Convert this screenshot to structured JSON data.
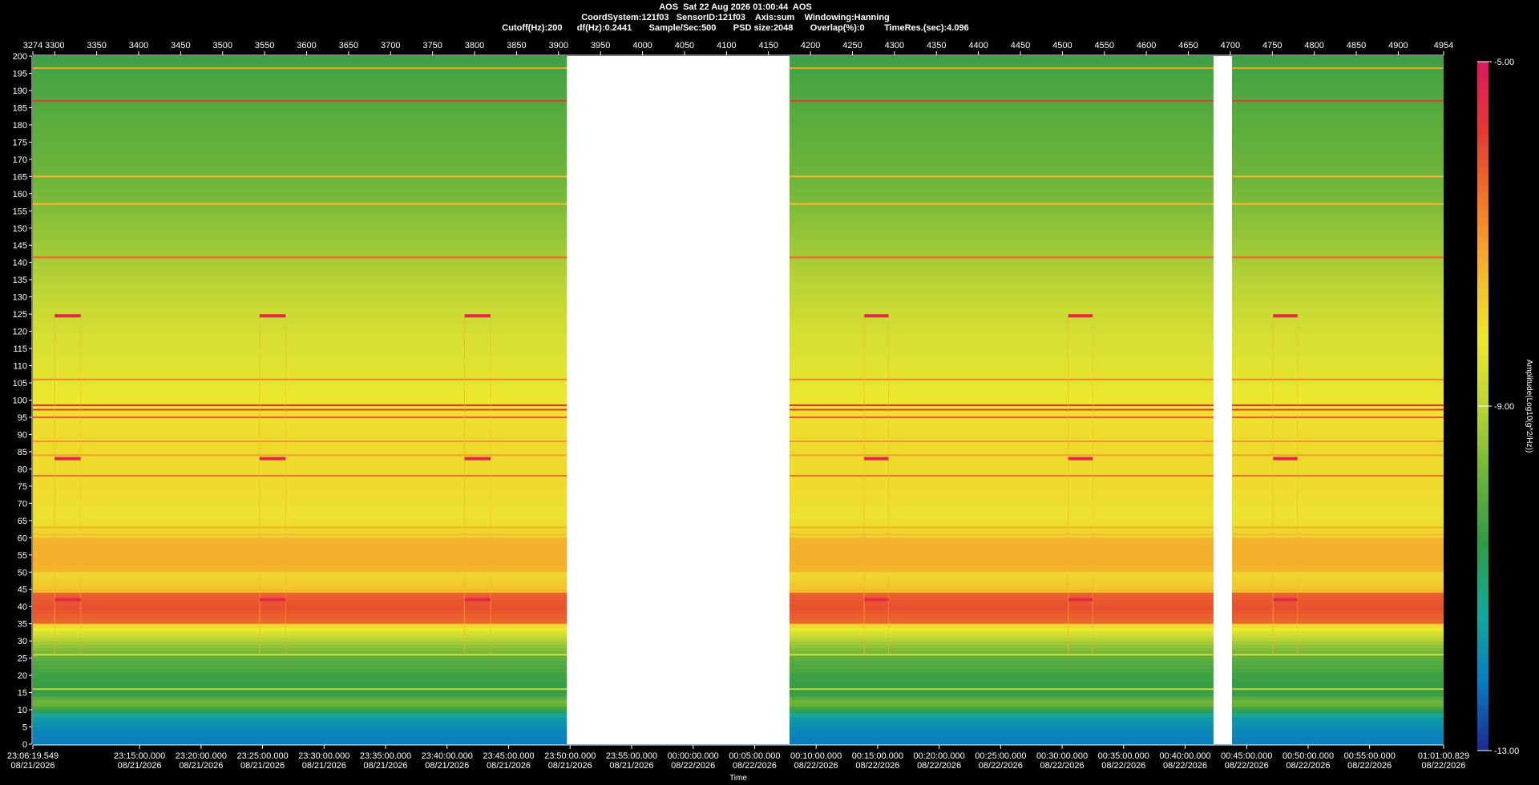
{
  "header": {
    "line1": "AOS  Sat 22 Aug 2026 01:00:44  AOS",
    "line2": "CoordSystem:121f03   SensorID:121f03    Axis:sum    Windowing:Hanning",
    "line3": "Cutoff(Hz):200      df(Hz):0.2441       Sample/Sec:500       PSD size:2048       Overlap(%):0        TimeRes.(sec):4.096"
  },
  "colors": {
    "background": "#000000",
    "colormap": [
      "#1b2a8f",
      "#0a7cc0",
      "#12a99a",
      "#2f9a47",
      "#6db43a",
      "#bcd436",
      "#ece82f",
      "#f5b32c",
      "#f0752a",
      "#e23a31",
      "#e0165f"
    ],
    "gap": "#ffffff"
  },
  "chart_data": {
    "type": "heatmap",
    "title": "",
    "xlabel": "Time",
    "ylabel": "",
    "ylim": [
      0,
      200
    ],
    "xlim_top": [
      3274,
      4954
    ],
    "top_ticks": [
      "3274",
      "3300",
      "3350",
      "3400",
      "3450",
      "3500",
      "3550",
      "3600",
      "3650",
      "3700",
      "3750",
      "3800",
      "3850",
      "3900",
      "3950",
      "4000",
      "4050",
      "4100",
      "4150",
      "4200",
      "4250",
      "4300",
      "4350",
      "4400",
      "4450",
      "4500",
      "4550",
      "4600",
      "4650",
      "4700",
      "4750",
      "4800",
      "4850",
      "4900",
      "4954"
    ],
    "y_ticks": [
      "0",
      "5",
      "10",
      "15",
      "20",
      "25",
      "30",
      "35",
      "40",
      "45",
      "50",
      "55",
      "60",
      "65",
      "70",
      "75",
      "80",
      "85",
      "90",
      "95",
      "100",
      "105",
      "110",
      "115",
      "120",
      "125",
      "130",
      "135",
      "140",
      "145",
      "150",
      "155",
      "160",
      "165",
      "170",
      "175",
      "180",
      "185",
      "190",
      "195",
      "200"
    ],
    "time_ticks": [
      {
        "time": "23:06:19.549",
        "date": "08/21/2026",
        "sec": 0
      },
      {
        "time": "23:15:00.000",
        "date": "08/21/2026",
        "sec": 520.451
      },
      {
        "time": "23:20:00.000",
        "date": "08/21/2026",
        "sec": 820.451
      },
      {
        "time": "23:25:00.000",
        "date": "08/21/2026",
        "sec": 1120.451
      },
      {
        "time": "23:30:00.000",
        "date": "08/21/2026",
        "sec": 1420.451
      },
      {
        "time": "23:35:00.000",
        "date": "08/21/2026",
        "sec": 1720.451
      },
      {
        "time": "23:40:00.000",
        "date": "08/21/2026",
        "sec": 2020.451
      },
      {
        "time": "23:45:00.000",
        "date": "08/21/2026",
        "sec": 2320.451
      },
      {
        "time": "23:50:00.000",
        "date": "08/21/2026",
        "sec": 2620.451
      },
      {
        "time": "23:55:00.000",
        "date": "08/21/2026",
        "sec": 2920.451
      },
      {
        "time": "00:00:00.000",
        "date": "08/22/2026",
        "sec": 3220.451
      },
      {
        "time": "00:05:00.000",
        "date": "08/22/2026",
        "sec": 3520.451
      },
      {
        "time": "00:10:00.000",
        "date": "08/22/2026",
        "sec": 3820.451
      },
      {
        "time": "00:15:00.000",
        "date": "08/22/2026",
        "sec": 4120.451
      },
      {
        "time": "00:20:00.000",
        "date": "08/22/2026",
        "sec": 4420.451
      },
      {
        "time": "00:25:00.000",
        "date": "08/22/2026",
        "sec": 4720.451
      },
      {
        "time": "00:30:00.000",
        "date": "08/22/2026",
        "sec": 5020.451
      },
      {
        "time": "00:35:00.000",
        "date": "08/22/2026",
        "sec": 5320.451
      },
      {
        "time": "00:40:00.000",
        "date": "08/22/2026",
        "sec": 5620.451
      },
      {
        "time": "00:45:00.000",
        "date": "08/22/2026",
        "sec": 5920.451
      },
      {
        "time": "00:50:00.000",
        "date": "08/22/2026",
        "sec": 6220.451
      },
      {
        "time": "00:55:00.000",
        "date": "08/22/2026",
        "sec": 6520.451
      },
      {
        "time": "01:01:00.829",
        "date": "08/22/2026",
        "sec": 6881.28
      }
    ],
    "time_range_sec": [
      0,
      6881.28
    ],
    "data_gaps": [
      {
        "from": 3910,
        "to": 4175
      },
      {
        "from": 4680,
        "to": 4702
      }
    ],
    "colorbar": {
      "label": "Amplitude(Log10(g^2/Hz))",
      "max": "-5.00",
      "mid": "-9.00",
      "min": "-13.00",
      "range": [
        -13,
        -5
      ]
    },
    "horizontal_lines_hz": [
      {
        "hz": 196.5,
        "level": -7.2
      },
      {
        "hz": 187,
        "level": -5.8
      },
      {
        "hz": 165,
        "level": -7.5
      },
      {
        "hz": 157,
        "level": -7.6
      },
      {
        "hz": 141.5,
        "level": -6.4
      },
      {
        "hz": 106,
        "level": -6.8
      },
      {
        "hz": 98.5,
        "level": -5.4
      },
      {
        "hz": 97.2,
        "level": -5.6
      },
      {
        "hz": 95,
        "level": -6.2
      },
      {
        "hz": 88,
        "level": -7.0
      },
      {
        "hz": 84,
        "level": -7.2
      },
      {
        "hz": 78,
        "level": -6.6
      },
      {
        "hz": 63,
        "level": -7.4
      },
      {
        "hz": 61,
        "level": -7.6
      },
      {
        "hz": 26,
        "level": -8.6
      },
      {
        "hz": 16,
        "level": -8.8
      }
    ],
    "bands_hz": [
      {
        "from": 35,
        "to": 44,
        "level": -6.0
      },
      {
        "from": 50,
        "to": 60,
        "level": -7.3
      }
    ],
    "periodic_events": [
      {
        "x_from": 3300,
        "x_to": 3331,
        "hz": [
          124.5,
          83,
          42
        ]
      },
      {
        "x_from": 3544,
        "x_to": 3575,
        "hz": [
          124.5,
          83,
          42
        ]
      },
      {
        "x_from": 3788,
        "x_to": 3819,
        "hz": [
          124.5,
          83,
          42
        ]
      },
      {
        "x_from": 4264,
        "x_to": 4293,
        "hz": [
          124.5,
          83,
          42
        ]
      },
      {
        "x_from": 4507,
        "x_to": 4536,
        "hz": [
          124.5,
          83,
          42
        ]
      },
      {
        "x_from": 4751,
        "x_to": 4780,
        "hz": [
          124.5,
          83,
          42
        ]
      }
    ],
    "grid": false
  }
}
